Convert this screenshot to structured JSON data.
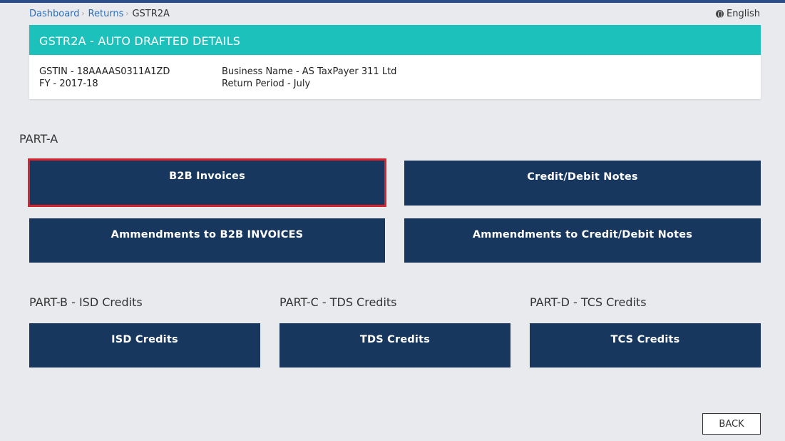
{
  "breadcrumb": {
    "dashboard": "Dashboard",
    "returns": "Returns",
    "current": "GSTR2A",
    "separator": "›"
  },
  "language": "English",
  "details": {
    "title": "GSTR2A - AUTO DRAFTED DETAILS",
    "gstin": "GSTIN - 18AAAAS0311A1ZD",
    "fy": "FY - 2017-18",
    "business_name": "Business Name - AS TaxPayer 311 Ltd",
    "return_period": "Return Period - July"
  },
  "part_a": {
    "label": "PART-A",
    "tiles": [
      "B2B Invoices",
      "Credit/Debit Notes",
      "Ammendments to B2B INVOICES",
      "Ammendments to Credit/Debit Notes"
    ]
  },
  "part_b": {
    "label": "PART-B - ISD Credits",
    "tile": "ISD Credits"
  },
  "part_c": {
    "label": "PART-C - TDS Credits",
    "tile": "TDS Credits"
  },
  "part_d": {
    "label": "PART-D - TCS Credits",
    "tile": "TCS Credits"
  },
  "back_label": "BACK",
  "colors": {
    "tile": "#17375e",
    "header": "#1cc1bb",
    "selected_border": "#d9222c",
    "link": "#2a6ebb"
  }
}
